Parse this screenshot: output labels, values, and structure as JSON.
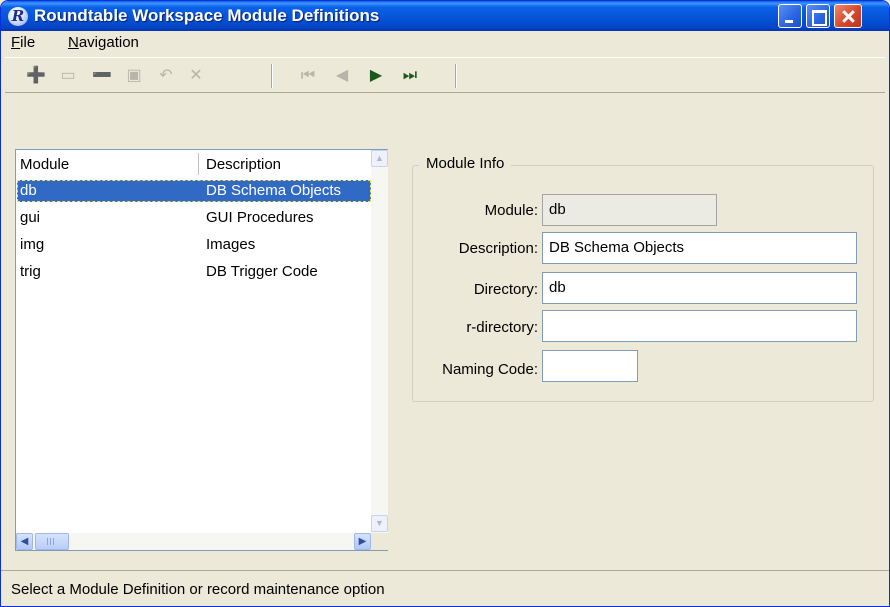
{
  "window": {
    "title": "Roundtable Workspace Module Definitions",
    "app_icon_glyph": "R"
  },
  "menu": [
    {
      "label": "File",
      "accel": "F",
      "rest": "ile"
    },
    {
      "label": "Navigation",
      "accel": "N",
      "rest": "avigation"
    }
  ],
  "toolbar": {
    "buttons": [
      {
        "name": "add-record-icon",
        "glyph": "➕",
        "enabled": true
      },
      {
        "name": "copy-record-icon",
        "glyph": "▭",
        "enabled": false
      },
      {
        "name": "delete-record-icon",
        "glyph": "➖",
        "enabled": true
      },
      {
        "name": "save-record-icon",
        "glyph": "▣",
        "enabled": false
      },
      {
        "name": "undo-icon",
        "glyph": "↶",
        "enabled": false
      },
      {
        "name": "cancel-icon",
        "glyph": "✕",
        "enabled": false
      },
      {
        "name": "first-record-icon",
        "glyph": "⏮",
        "enabled": false
      },
      {
        "name": "prev-record-icon",
        "glyph": "◀",
        "enabled": false
      },
      {
        "name": "next-record-icon",
        "glyph": "▶",
        "enabled": true
      },
      {
        "name": "last-record-icon",
        "glyph": "⏭",
        "enabled": true
      }
    ]
  },
  "list": {
    "headers": {
      "module": "Module",
      "description": "Description"
    },
    "rows": [
      {
        "module": "db",
        "description": "DB Schema Objects",
        "selected": true
      },
      {
        "module": "gui",
        "description": "GUI Procedures",
        "selected": false
      },
      {
        "module": "img",
        "description": "Images",
        "selected": false
      },
      {
        "module": "trig",
        "description": "DB Trigger Code",
        "selected": false
      }
    ]
  },
  "module_info": {
    "title": "Module Info",
    "module_label": "Module:",
    "module_value": "db",
    "description_label": "Description:",
    "description_value": "DB Schema Objects",
    "directory_label": "Directory:",
    "directory_value": "db",
    "rdirectory_label": "r-directory:",
    "rdirectory_value": "",
    "naming_code_label": "Naming Code:",
    "naming_code_value": ""
  },
  "status": {
    "text": "Select a Module Definition or record maintenance option"
  }
}
